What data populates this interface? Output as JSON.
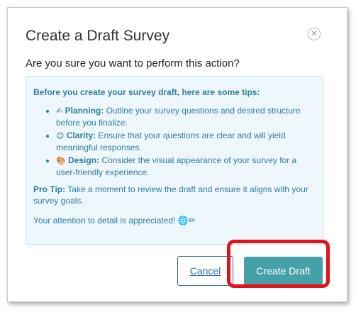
{
  "dialog": {
    "title": "Create a Draft Survey",
    "close_icon": "close-circle-icon",
    "question": "Are you sure you want to perform this action?"
  },
  "tips": {
    "heading": "Before you create your survey draft, here are some tips:",
    "items": [
      {
        "icon": "✍",
        "label": "Planning:",
        "text": "Outline your survey questions and desired structure before you finalize."
      },
      {
        "icon": "😊",
        "label": "Clarity:",
        "text": "Ensure that your questions are clear and will yield meaningful responses."
      },
      {
        "icon": "🎨",
        "label": "Design:",
        "text": "Consider the visual appearance of your survey for a user-friendly experience."
      }
    ],
    "pro_tip_label": "Pro Tip:",
    "pro_tip_text": "Take a moment to review the draft and ensure it aligns with your survey goals.",
    "closing": "Your attention to detail is appreciated! 🌐✏"
  },
  "buttons": {
    "cancel": "Cancel",
    "create": "Create Draft"
  },
  "colors": {
    "tips_text": "#2e7ea1",
    "tips_bg": "#eef7fb",
    "primary_button": "#46a0a8",
    "highlight": "#e0141c"
  }
}
